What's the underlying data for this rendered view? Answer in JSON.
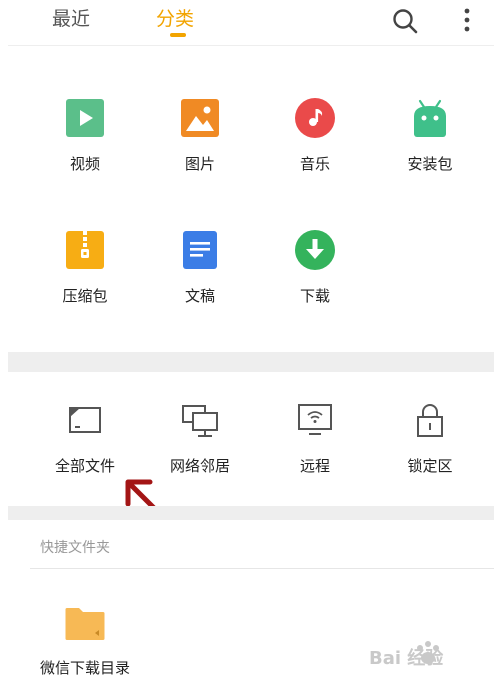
{
  "header": {
    "tabs": [
      {
        "label": "最近",
        "active": false
      },
      {
        "label": "分类",
        "active": true
      }
    ],
    "accent_color": "#f2a400",
    "actions": [
      {
        "icon": "search-icon"
      },
      {
        "icon": "more-vertical-icon"
      }
    ]
  },
  "categories": [
    {
      "label": "视频",
      "icon": "video-icon",
      "color": "#5bbf8a"
    },
    {
      "label": "图片",
      "icon": "image-icon",
      "color": "#f08a24"
    },
    {
      "label": "音乐",
      "icon": "music-icon",
      "color": "#ea4a4a"
    },
    {
      "label": "安装包",
      "icon": "android-icon",
      "color": "#3fc08a"
    },
    {
      "label": "压缩包",
      "icon": "archive-icon",
      "color": "#f7ad14"
    },
    {
      "label": "文稿",
      "icon": "document-icon",
      "color": "#3b7de6"
    },
    {
      "label": "下载",
      "icon": "download-icon",
      "color": "#34b35c"
    }
  ],
  "locations": [
    {
      "label": "全部文件",
      "icon": "storage-icon"
    },
    {
      "label": "网络邻居",
      "icon": "network-neighborhood-icon"
    },
    {
      "label": "远程",
      "icon": "remote-icon"
    },
    {
      "label": "锁定区",
      "icon": "lock-icon"
    }
  ],
  "quick_folders": {
    "title": "快捷文件夹",
    "items": [
      {
        "label": "微信下载目录",
        "icon": "folder-icon",
        "color": "#f7b955"
      }
    ]
  },
  "watermark": {
    "text": "Bai 经验",
    "icon": "baidu-paw-icon"
  }
}
